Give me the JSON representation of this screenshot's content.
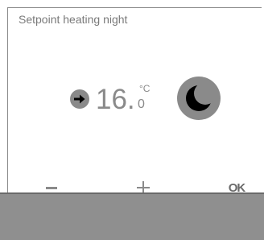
{
  "screen": {
    "title": "Setpoint heating night"
  },
  "setpoint": {
    "value_int": "16.",
    "value_decimal": "0",
    "unit": "°C",
    "mode_icon": "moon-icon",
    "indicator_icon": "arrow-right-icon"
  },
  "softkeys": {
    "minus_label": "−",
    "plus_label": "+",
    "ok_label": "OK"
  },
  "colors": {
    "text": "#8a8a8a",
    "footer": "#8f8f8f",
    "icon_circle": "#8a8a8a",
    "icon_fg": "#000000"
  }
}
